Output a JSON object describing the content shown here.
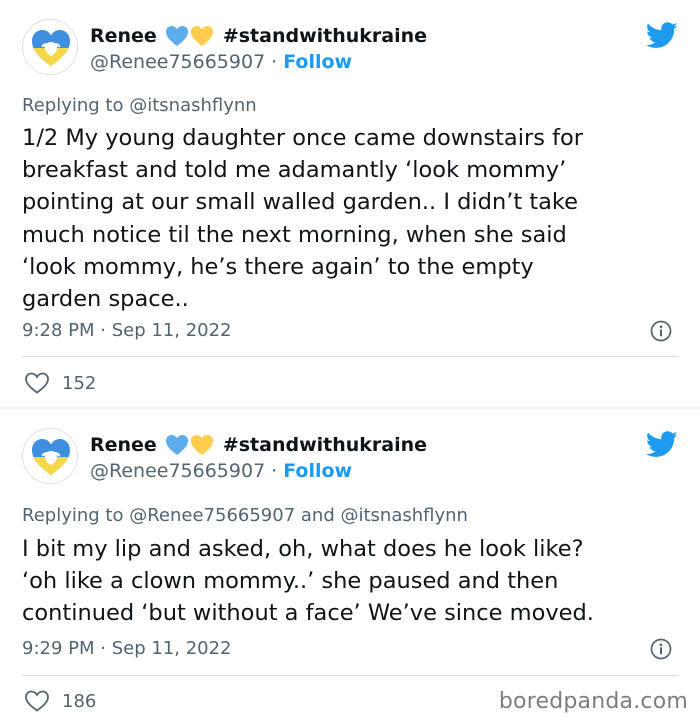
{
  "tweets": [
    {
      "name": "Renee",
      "tag": "#standwithukraine",
      "handle": "@Renee75665907",
      "separator": "·",
      "follow": "Follow",
      "replying_prefix": "Replying to",
      "replying_to": "@itsnashflynn",
      "text": "1/2 My young daughter once came downstairs for\nbreakfast and told me adamantly ‘look mommy’\npointing at our small walled garden.. I didn’t take\nmuch notice til the next morning, when she said\n‘look mommy, he’s there again’ to the empty\ngarden space..",
      "time": "9:28 PM · Sep 11, 2022",
      "likes": "152"
    },
    {
      "name": "Renee",
      "tag": "#standwithukraine",
      "handle": "@Renee75665907",
      "separator": "·",
      "follow": "Follow",
      "replying_prefix": "Replying to",
      "replying_to": "@Renee75665907 and @itsnashflynn",
      "text": "I bit my lip and asked, oh, what does he look like?\n‘oh like a clown mommy..’ she paused and then\ncontinued ‘but without a face’ We’ve since moved.",
      "time": "9:29 PM · Sep 11, 2022",
      "likes": "186"
    }
  ],
  "watermark": "boredpanda.com",
  "colors": {
    "twitter_blue": "#1d9bf0",
    "heart_blue": "#5dadec",
    "heart_yellow": "#ffcc4d",
    "ukraine_blue": "#3f8fe0",
    "ukraine_yellow": "#f5d84a",
    "secondary_text": "#536471"
  },
  "icons": [
    "twitter-bird-icon",
    "info-icon",
    "heart-icon",
    "blue-heart-icon",
    "yellow-heart-icon"
  ]
}
